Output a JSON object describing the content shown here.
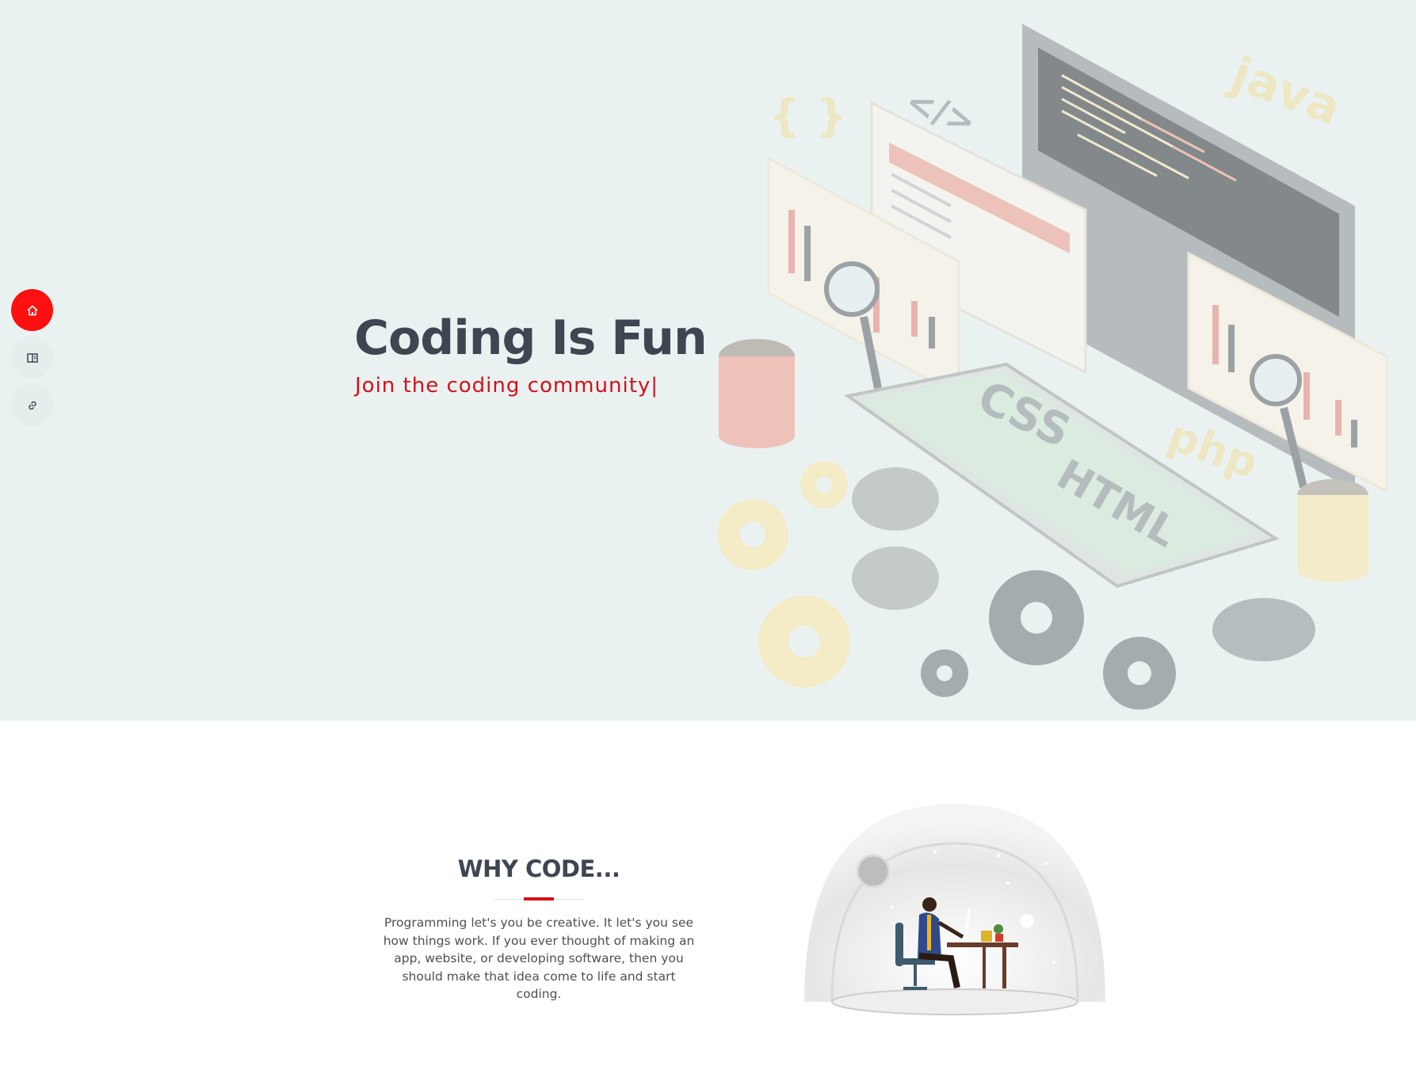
{
  "hero": {
    "title": "Coding Is Fun",
    "subtitle": "Join the coding community|",
    "background_color": "#eaf2f1",
    "title_color": "#3e4651",
    "subtitle_color": "#d4111a",
    "illustration_labels": [
      "{ }",
      "</>",
      "java",
      "CSS",
      "HTML",
      "php"
    ]
  },
  "side_nav": {
    "items": [
      {
        "icon": "home-icon",
        "active": true
      },
      {
        "icon": "book-icon",
        "active": false
      },
      {
        "icon": "link-icon",
        "active": false
      }
    ],
    "active_color": "#ff1010"
  },
  "why_code": {
    "title": "WHY CODE...",
    "body": "Programming let's you be creative. It let's you see how things work. If you ever thought of making an app, website, or developing software, then you should make that idea come to life and start coding.",
    "accent_color": "#d4111a"
  }
}
